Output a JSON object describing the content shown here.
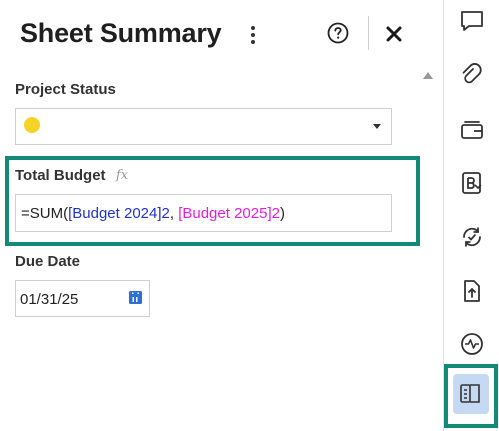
{
  "panel": {
    "title": "Sheet Summary",
    "menu_icon": "kebab-menu-icon",
    "help_icon": "help-circle-icon",
    "close_icon": "close-icon"
  },
  "fields": {
    "project_status": {
      "label": "Project Status",
      "value_color": "#f5d327"
    },
    "total_budget": {
      "label": "Total Budget",
      "formula_icon": "fx-icon",
      "formula_prefix": "=SUM(",
      "ref1": "[Budget 2024]2",
      "separator": ", ",
      "ref2": "[Budget 2025]2",
      "formula_suffix": ")"
    },
    "due_date": {
      "label": "Due Date",
      "value": "01/31/25",
      "icon": "calendar-icon"
    }
  },
  "rail": {
    "items": [
      {
        "name": "comments-icon"
      },
      {
        "name": "attachments-icon"
      },
      {
        "name": "proofs-icon"
      },
      {
        "name": "brandfolder-icon"
      },
      {
        "name": "update-requests-icon"
      },
      {
        "name": "publish-icon"
      },
      {
        "name": "activity-log-icon"
      },
      {
        "name": "sheet-summary-icon",
        "active": true
      }
    ]
  },
  "colors": {
    "accent": "#138a76",
    "ref_blue": "#1f33c8",
    "ref_pink": "#e01ee0"
  }
}
